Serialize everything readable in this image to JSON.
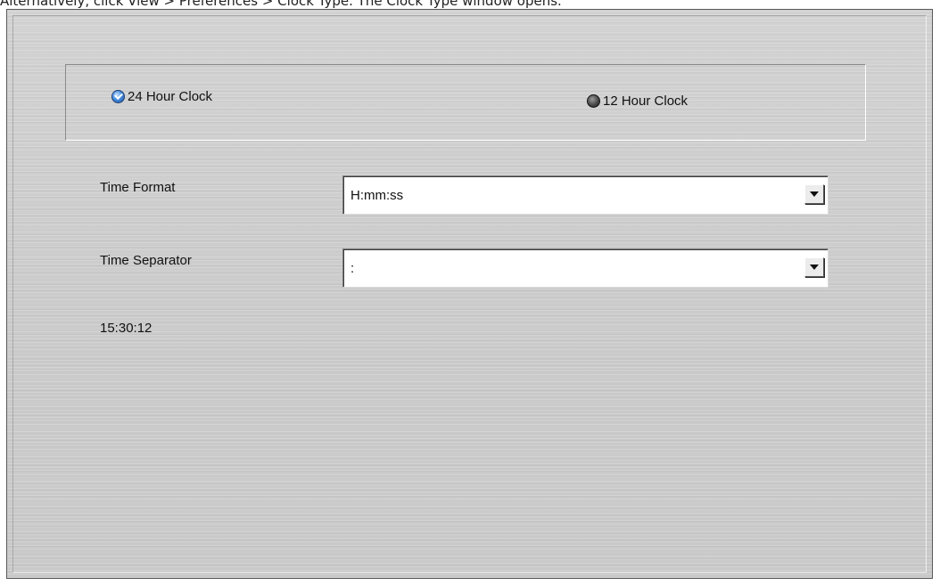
{
  "caption": "Alternatively, click View > Preferences > Clock Type. The Clock Type window opens.",
  "clock_type": {
    "option_24": "24 Hour Clock",
    "option_12": "12 Hour Clock",
    "selected": "24 Hour Clock"
  },
  "time_format": {
    "label": "Time Format",
    "value": "H:mm:ss"
  },
  "time_separator": {
    "label": "Time Separator",
    "value": ":"
  },
  "preview_time": "15:30:12",
  "colors": {
    "accent_selected": "#4a90e2",
    "unselected": "#4a4a4a",
    "panel_bg": "#cbcbcb"
  },
  "icons": {
    "radio_selected": "radio-checked-icon",
    "radio_unselected": "radio-unchecked-icon",
    "dropdown": "chevron-down-icon"
  }
}
